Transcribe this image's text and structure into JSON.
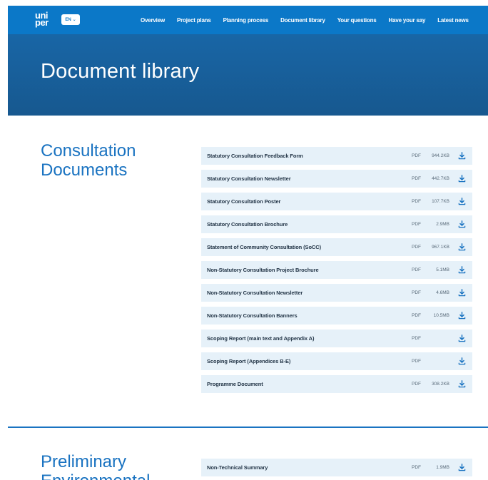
{
  "header": {
    "logo_line1": "uni",
    "logo_line2": "per",
    "language": "EN",
    "nav": [
      "Overview",
      "Project plans",
      "Planning process",
      "Document library",
      "Your questions",
      "Have your say",
      "Latest news"
    ]
  },
  "hero": {
    "title": "Document library"
  },
  "sections": [
    {
      "title": "Consultation Documents",
      "documents": [
        {
          "name": "Statutory Consultation Feedback Form",
          "type": "PDF",
          "size": "944.2KB"
        },
        {
          "name": "Statutory Consultation Newsletter",
          "type": "PDF",
          "size": "442.7KB"
        },
        {
          "name": "Statutory Consultation Poster",
          "type": "PDF",
          "size": "107.7KB"
        },
        {
          "name": "Statutory Consultation Brochure",
          "type": "PDF",
          "size": "2.9MB"
        },
        {
          "name": "Statement of Community Consultation (SoCC)",
          "type": "PDF",
          "size": "967.1KB"
        },
        {
          "name": "Non-Statutory Consultation Project Brochure",
          "type": "PDF",
          "size": "5.1MB"
        },
        {
          "name": "Non-Statutory Consultation Newsletter",
          "type": "PDF",
          "size": "4.6MB"
        },
        {
          "name": "Non-Statutory Consultation Banners",
          "type": "PDF",
          "size": "10.5MB"
        },
        {
          "name": "Scoping Report (main text and Appendix A)",
          "type": "PDF",
          "size": ""
        },
        {
          "name": "Scoping Report (Appendices B-E)",
          "type": "PDF",
          "size": ""
        },
        {
          "name": "Programme Document",
          "type": "PDF",
          "size": "308.2KB"
        }
      ]
    },
    {
      "title": "Preliminary Environmental",
      "documents": [
        {
          "name": "Non-Technical Summary",
          "type": "PDF",
          "size": "1.9MB"
        }
      ]
    }
  ],
  "colors": {
    "brand": "#0b78c8",
    "hero": "#17588f",
    "accent": "#1a73c1",
    "row_bg": "#e6f1f9"
  },
  "icons": {
    "download": "download-icon",
    "language_chevron": "chevron-down-icon"
  }
}
